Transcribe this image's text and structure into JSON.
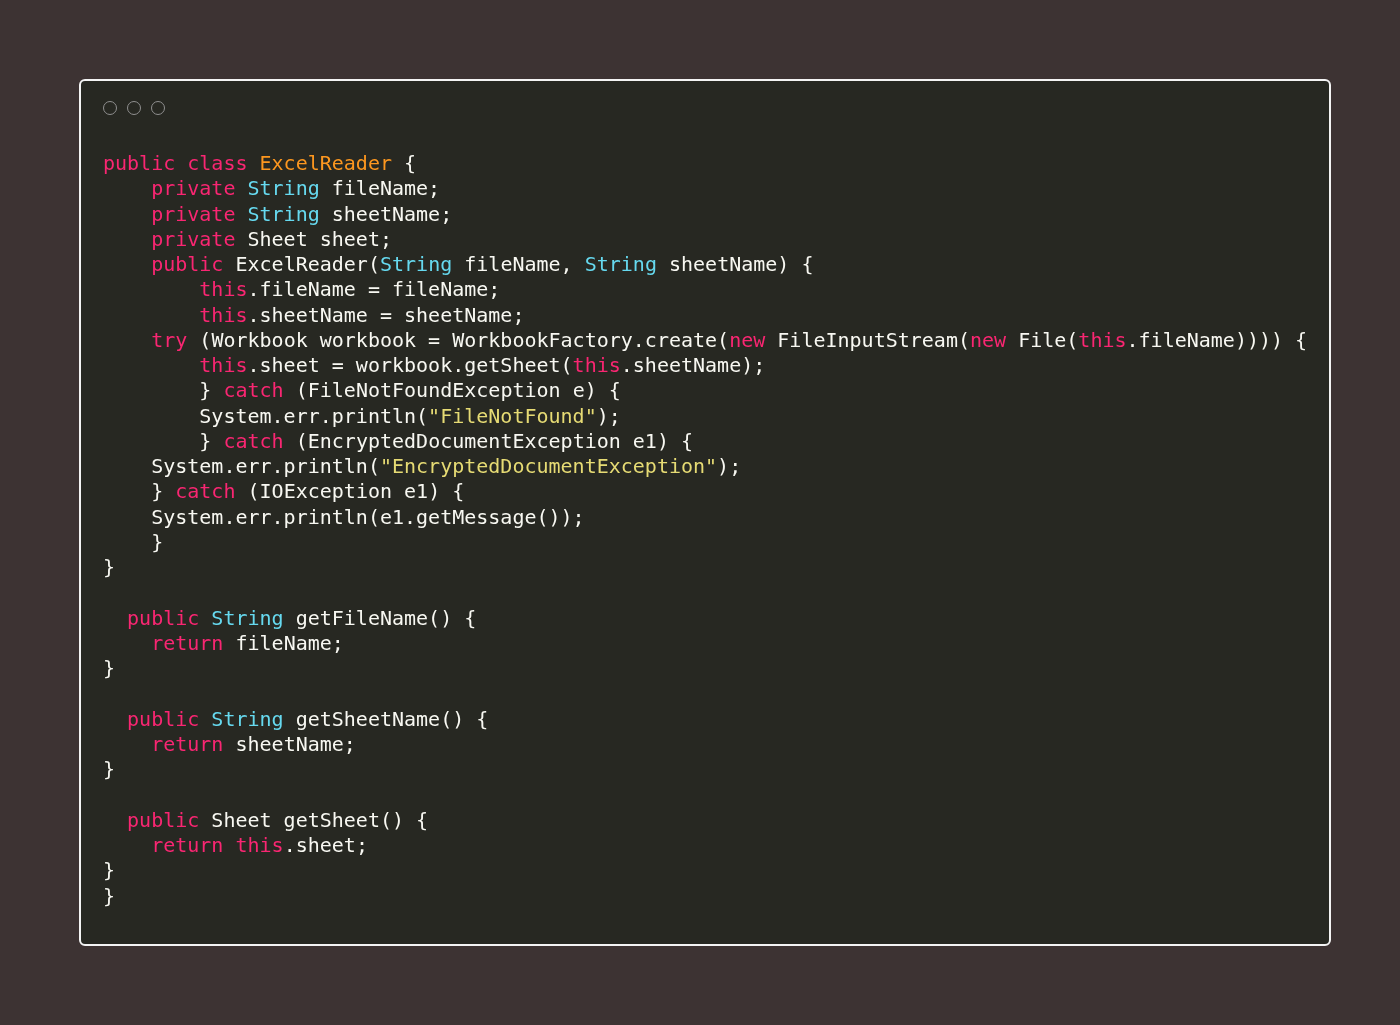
{
  "window": {
    "controls": [
      {
        "kind": "circle"
      },
      {
        "kind": "circle"
      },
      {
        "kind": "circle"
      }
    ]
  },
  "code": [
    {
      "kind": "code",
      "tokens": [
        {
          "text": "public class",
          "kind": "kw"
        },
        {
          "text": " ExcelReader",
          "kind": "cls"
        },
        {
          "text": " {",
          "kind": "plain"
        }
      ]
    },
    {
      "kind": "code",
      "tokens": [
        {
          "text": "    private",
          "kind": "kw"
        },
        {
          "text": " String",
          "kind": "type"
        },
        {
          "text": " fileName;",
          "kind": "plain"
        }
      ]
    },
    {
      "kind": "code",
      "tokens": [
        {
          "text": "    private",
          "kind": "kw"
        },
        {
          "text": " String",
          "kind": "type"
        },
        {
          "text": " sheetName;",
          "kind": "plain"
        }
      ]
    },
    {
      "kind": "code",
      "tokens": [
        {
          "text": "    private",
          "kind": "kw"
        },
        {
          "text": " Sheet sheet;",
          "kind": "plain"
        }
      ]
    },
    {
      "kind": "code",
      "tokens": [
        {
          "text": "    public",
          "kind": "kw"
        },
        {
          "text": " ExcelReader(",
          "kind": "plain"
        },
        {
          "text": "String",
          "kind": "type"
        },
        {
          "text": " fileName, ",
          "kind": "plain"
        },
        {
          "text": "String",
          "kind": "type"
        },
        {
          "text": " sheetName) {",
          "kind": "plain"
        }
      ]
    },
    {
      "kind": "code",
      "tokens": [
        {
          "text": "        this",
          "kind": "kw"
        },
        {
          "text": ".fileName = fileName;",
          "kind": "plain"
        }
      ]
    },
    {
      "kind": "code",
      "tokens": [
        {
          "text": "        this",
          "kind": "kw"
        },
        {
          "text": ".sheetName = sheetName;",
          "kind": "plain"
        }
      ]
    },
    {
      "kind": "code",
      "tokens": [
        {
          "text": "    try",
          "kind": "kw"
        },
        {
          "text": " (Workbook workbook = WorkbookFactory.create(",
          "kind": "plain"
        },
        {
          "text": "new",
          "kind": "kw"
        },
        {
          "text": " FileInputStream(",
          "kind": "plain"
        },
        {
          "text": "new",
          "kind": "kw"
        },
        {
          "text": " File(",
          "kind": "plain"
        },
        {
          "text": "this",
          "kind": "kw"
        },
        {
          "text": ".fileName)))) {",
          "kind": "plain"
        }
      ]
    },
    {
      "kind": "code",
      "tokens": [
        {
          "text": "        this",
          "kind": "kw"
        },
        {
          "text": ".sheet = workbook.getSheet(",
          "kind": "plain"
        },
        {
          "text": "this",
          "kind": "kw"
        },
        {
          "text": ".sheetName);",
          "kind": "plain"
        }
      ]
    },
    {
      "kind": "code",
      "tokens": [
        {
          "text": "        } ",
          "kind": "plain"
        },
        {
          "text": "catch",
          "kind": "kw"
        },
        {
          "text": " (FileNotFoundException e) {",
          "kind": "plain"
        }
      ]
    },
    {
      "kind": "code",
      "tokens": [
        {
          "text": "        System.err.println(",
          "kind": "plain"
        },
        {
          "text": "\"FileNotFound\"",
          "kind": "str"
        },
        {
          "text": ");",
          "kind": "plain"
        }
      ]
    },
    {
      "kind": "code",
      "tokens": [
        {
          "text": "        } ",
          "kind": "plain"
        },
        {
          "text": "catch",
          "kind": "kw"
        },
        {
          "text": " (EncryptedDocumentException e1) {",
          "kind": "plain"
        }
      ]
    },
    {
      "kind": "code",
      "tokens": [
        {
          "text": "    System.err.println(",
          "kind": "plain"
        },
        {
          "text": "\"EncryptedDocumentException\"",
          "kind": "str"
        },
        {
          "text": ");",
          "kind": "plain"
        }
      ]
    },
    {
      "kind": "code",
      "tokens": [
        {
          "text": "    } ",
          "kind": "plain"
        },
        {
          "text": "catch",
          "kind": "kw"
        },
        {
          "text": " (IOException e1) {",
          "kind": "plain"
        }
      ]
    },
    {
      "kind": "code",
      "tokens": [
        {
          "text": "    System.err.println(e1.getMessage());",
          "kind": "plain"
        }
      ]
    },
    {
      "kind": "code",
      "tokens": [
        {
          "text": "    }",
          "kind": "plain"
        }
      ]
    },
    {
      "kind": "code",
      "tokens": [
        {
          "text": "}",
          "kind": "plain"
        }
      ]
    },
    {
      "kind": "blank"
    },
    {
      "kind": "code",
      "tokens": [
        {
          "text": "  public",
          "kind": "kw"
        },
        {
          "text": " String",
          "kind": "type"
        },
        {
          "text": " getFileName() {",
          "kind": "plain"
        }
      ]
    },
    {
      "kind": "code",
      "tokens": [
        {
          "text": "    return",
          "kind": "kw"
        },
        {
          "text": " fileName;",
          "kind": "plain"
        }
      ]
    },
    {
      "kind": "code",
      "tokens": [
        {
          "text": "}",
          "kind": "plain"
        }
      ]
    },
    {
      "kind": "blank"
    },
    {
      "kind": "code",
      "tokens": [
        {
          "text": "  public",
          "kind": "kw"
        },
        {
          "text": " String",
          "kind": "type"
        },
        {
          "text": " getSheetName() {",
          "kind": "plain"
        }
      ]
    },
    {
      "kind": "code",
      "tokens": [
        {
          "text": "    return",
          "kind": "kw"
        },
        {
          "text": " sheetName;",
          "kind": "plain"
        }
      ]
    },
    {
      "kind": "code",
      "tokens": [
        {
          "text": "}",
          "kind": "plain"
        }
      ]
    },
    {
      "kind": "blank"
    },
    {
      "kind": "code",
      "tokens": [
        {
          "text": "  public",
          "kind": "kw"
        },
        {
          "text": " Sheet getSheet() {",
          "kind": "plain"
        }
      ]
    },
    {
      "kind": "code",
      "tokens": [
        {
          "text": "    return",
          "kind": "kw"
        },
        {
          "text": " this",
          "kind": "kw"
        },
        {
          "text": ".sheet;",
          "kind": "plain"
        }
      ]
    },
    {
      "kind": "code",
      "tokens": [
        {
          "text": "}",
          "kind": "plain"
        }
      ]
    },
    {
      "kind": "code",
      "tokens": [
        {
          "text": "}",
          "kind": "plain"
        }
      ]
    }
  ]
}
